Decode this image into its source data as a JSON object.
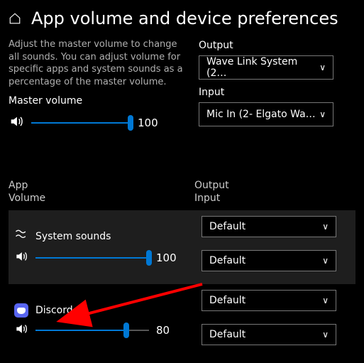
{
  "header": {
    "title": "App volume and device preferences"
  },
  "description": "Adjust the master volume to change all sounds. You can adjust volume for specific apps and system sounds as a percentage of the master volume.",
  "output": {
    "label": "Output",
    "selected": "Wave Link System (2…"
  },
  "input": {
    "label": "Input",
    "selected": "Mic In (2- Elgato Wa…"
  },
  "master": {
    "label": "Master volume",
    "value": "100",
    "percent": 100
  },
  "columns": {
    "leftTop": "App",
    "leftBottom": "Volume",
    "rightTop": "Output",
    "rightBottom": "Input"
  },
  "apps": [
    {
      "name": "System sounds",
      "volume": "100",
      "percent": 100,
      "output": "Default",
      "input": "Default",
      "highlight": true,
      "icon": "wave"
    },
    {
      "name": "Discord",
      "volume": "80",
      "percent": 80,
      "output": "Default",
      "input": "Default",
      "highlight": false,
      "icon": "discord"
    }
  ]
}
